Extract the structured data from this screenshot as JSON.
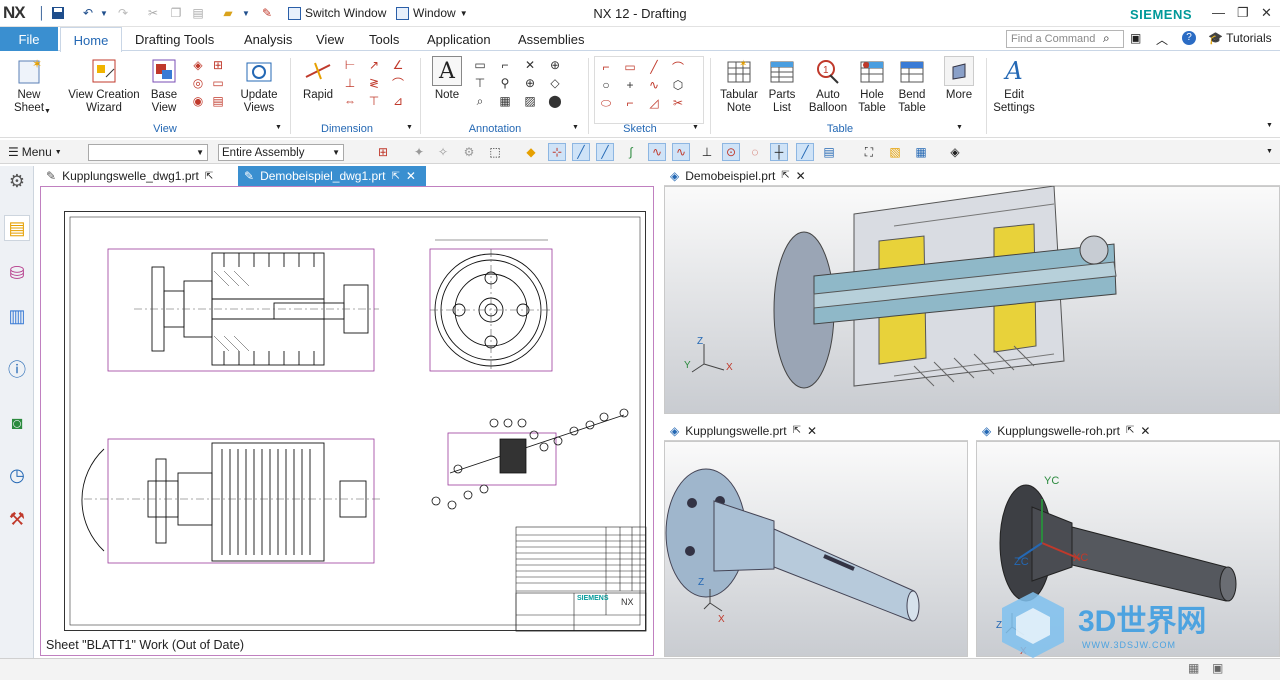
{
  "app": {
    "logo": "NX",
    "title": "NX 12 - Drafting",
    "brand": "SIEMENS",
    "switch_window": "Switch Window",
    "window_menu": "Window"
  },
  "ribbon_tabs": [
    "File",
    "Home",
    "Drafting Tools",
    "Analysis",
    "View",
    "Tools",
    "Application",
    "Assemblies"
  ],
  "find_command_placeholder": "Find a Command",
  "tutorials": "Tutorials",
  "ribbon": {
    "new_sheet": "New\nSheet",
    "view_creation_wizard": "View Creation\nWizard",
    "base_view": "Base\nView",
    "update_views": "Update\nViews",
    "rapid": "Rapid",
    "note": "Note",
    "tabular_note": "Tabular\nNote",
    "parts_list": "Parts\nList",
    "auto_balloon": "Auto\nBalloon",
    "hole_table": "Hole\nTable",
    "bend_table": "Bend\nTable",
    "more": "More",
    "edit_settings": "Edit\nSettings",
    "groups": {
      "view": "View",
      "dimension": "Dimension",
      "annotation": "Annotation",
      "sketch": "Sketch",
      "table": "Table"
    }
  },
  "toolbar2": {
    "menu": "Menu",
    "filter": "",
    "scope": "Entire Assembly"
  },
  "doc_tabs": [
    {
      "name": "Kupplungswelle_dwg1.prt"
    },
    {
      "name": "Demobeispiel_dwg1.prt"
    }
  ],
  "sheet_status": "Sheet \"BLATT1\" Work (Out of Date)",
  "viewports": [
    {
      "name": "Demobeispiel.prt"
    },
    {
      "name": "Kupplungswelle.prt"
    },
    {
      "name": "Kupplungswelle-roh.prt"
    }
  ],
  "title_block": {
    "company": "SIEMENS",
    "product": "NX"
  },
  "axes": {
    "x": "X",
    "y": "Y",
    "z": "Z",
    "xc": "XC",
    "yc": "YC",
    "zc": "ZC"
  },
  "watermark": {
    "text": "3D世界网",
    "url": "WWW.3DSJW.COM"
  },
  "colors": {
    "file_tab": "#3a8fd0",
    "accent": "#2468b4",
    "siemens": "#009999"
  }
}
